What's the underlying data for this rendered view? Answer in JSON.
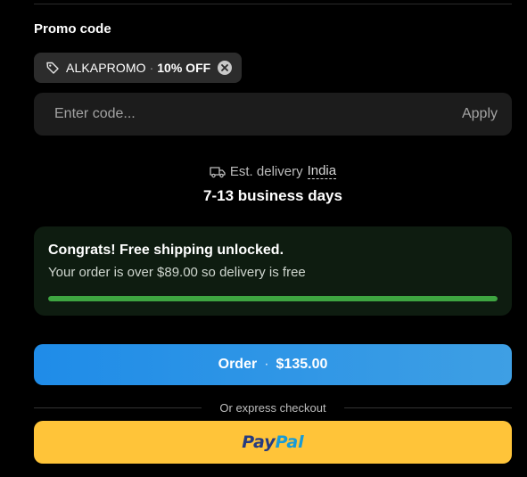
{
  "promo": {
    "label": "Promo code",
    "applied_code": "ALKAPROMO",
    "separator": "·",
    "applied_discount": "10% OFF",
    "input_placeholder": "Enter code...",
    "input_value": "",
    "apply_label": "Apply"
  },
  "delivery": {
    "prefix": "Est. delivery",
    "country": "India",
    "days": "7-13 business days"
  },
  "shipping": {
    "title": "Congrats! Free shipping unlocked.",
    "subtitle": "Your order is over $89.00 so delivery is free",
    "progress": 1.0
  },
  "order": {
    "label": "Order",
    "separator": "·",
    "amount": "$135.00"
  },
  "express": {
    "divider_text": "Or express checkout"
  },
  "paypal": {
    "brand_part1": "Pay",
    "brand_part2": "Pal"
  },
  "colors": {
    "background": "#000000",
    "success_green": "#3ea541",
    "order_blue": "#1f8ce8",
    "paypal_yellow": "#ffc439",
    "paypal_dark_blue": "#253b80",
    "paypal_light_blue": "#179bd7"
  },
  "icons": {
    "tag": "tag-icon",
    "remove": "close-circle-icon",
    "truck": "truck-icon"
  }
}
